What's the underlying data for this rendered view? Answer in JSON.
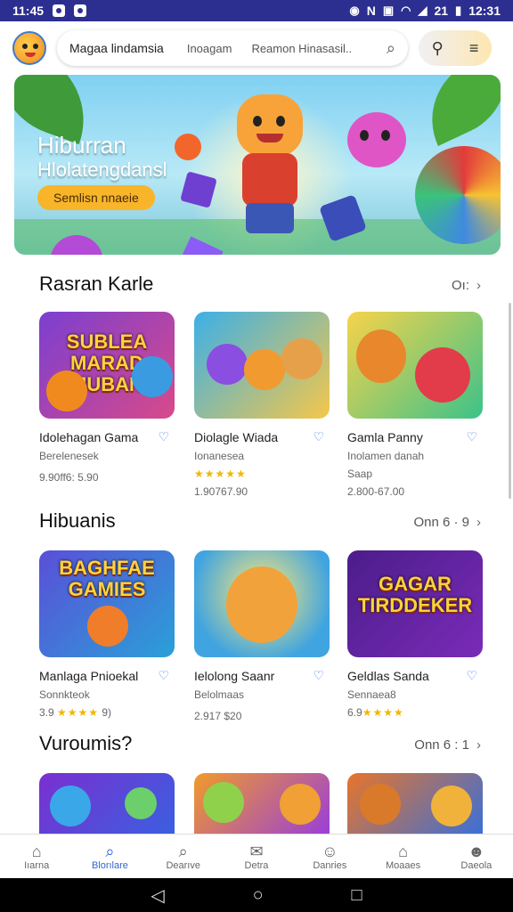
{
  "status_bar": {
    "time": "11:45",
    "right_time": "12:31",
    "right_text": "N",
    "signal_text": "21"
  },
  "search": {
    "query_primary": "Magaa lindamsia",
    "query_secondary": "Inoagam",
    "query_tertiary": "Reamon Hinasasil..."
  },
  "banner": {
    "title": "Hiburran",
    "subtitle": "Hlolatengdansl",
    "cta_label": "Semlisn nnaeie"
  },
  "sections": [
    {
      "title": "Rasran Karle",
      "see_all": "Oı:",
      "cards": [
        {
          "thumb_text": "SUBLEA MARAD MUBAN",
          "name": "Idolehagan Gama",
          "sub": "Berelenesek",
          "rating_text": "9.90ff6: 5.90",
          "stars": ""
        },
        {
          "thumb_text": "",
          "name": "Diolagle Wiada",
          "sub": "Ionanesea",
          "rating_text": "1.90767.90",
          "stars": "★★★★★"
        },
        {
          "thumb_text": "",
          "name": "Gamla Panny",
          "sub": "Inolamen danah",
          "rating_text": "2.800-67.00",
          "stars": "",
          "extra": "Saap"
        }
      ]
    },
    {
      "title": "Hibuanis",
      "see_all": "Onn 6 · 9",
      "cards": [
        {
          "thumb_text": "BAGHFAE GAMIES",
          "name": "Manlaga Pnioekal",
          "sub": "Sonnkteok",
          "rating_text": "3.9 ",
          "stars": "★★★★",
          "rating_suffix": " 9)"
        },
        {
          "thumb_text": "",
          "name": "Ielolong Saanr",
          "sub": "Belolmaas",
          "rating_text": "2.917 $20",
          "stars": ""
        },
        {
          "thumb_text": "GAGAR TIRDDEKER",
          "name": "Geldlas Sanda",
          "sub": "Sennaea8",
          "rating_text": "6.9",
          "stars": "★★★★"
        }
      ]
    },
    {
      "title": "Vuroumis?",
      "see_all": "Onn 6 : 1",
      "cards": [
        {
          "thumb_text": "",
          "name": "",
          "sub": "",
          "rating_text": "",
          "stars": ""
        },
        {
          "thumb_text": "",
          "name": "",
          "sub": "",
          "rating_text": "",
          "stars": ""
        },
        {
          "thumb_text": "",
          "name": "",
          "sub": "",
          "rating_text": "",
          "stars": ""
        }
      ]
    }
  ],
  "navbar": [
    {
      "label": "Iıarna",
      "icon": "home-icon",
      "active": false
    },
    {
      "label": "Blorılare",
      "icon": "search-icon",
      "active": true
    },
    {
      "label": "Dearıve",
      "icon": "search-icon",
      "active": false
    },
    {
      "label": "Detra",
      "icon": "mail-icon",
      "active": false
    },
    {
      "label": "Danries",
      "icon": "person-icon",
      "active": false
    },
    {
      "label": "Moaaes",
      "icon": "house-icon",
      "active": false
    },
    {
      "label": "Daeola",
      "icon": "profile-icon",
      "active": false
    }
  ],
  "colors": {
    "status_bar": "#2c2f8f",
    "accent": "#2e67d4",
    "star": "#f2b600",
    "cta": "#f8b52a"
  }
}
